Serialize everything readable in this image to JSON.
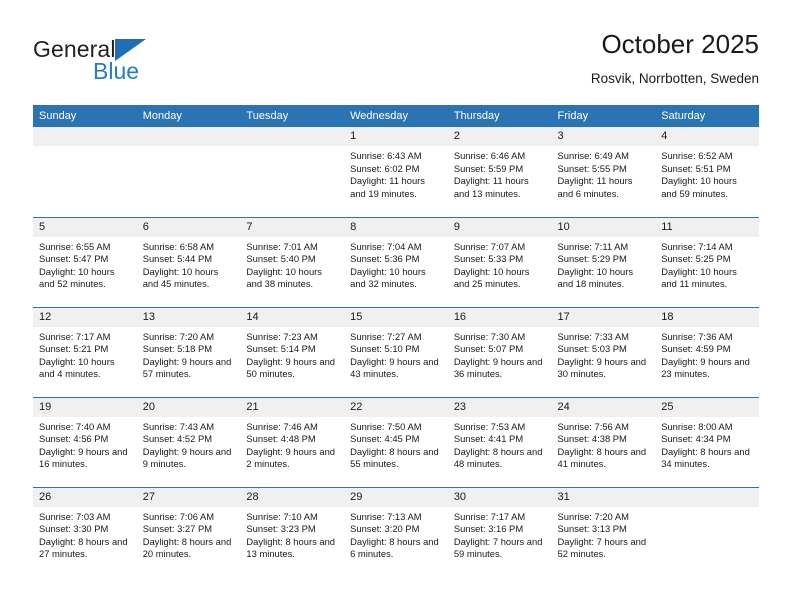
{
  "brand": {
    "name_top": "General",
    "name_bottom": "Blue",
    "logo_icon": "triangle-logo-icon",
    "accent_color": "#1f7ec4"
  },
  "header": {
    "title": "October 2025",
    "subtitle": "Rosvik, Norrbotten, Sweden"
  },
  "theme": {
    "header_blue": "#2b74b4",
    "daynum_band": "#f0f0f0",
    "text": "#1a1a1a"
  },
  "calendar": {
    "weekday_headers": [
      "Sunday",
      "Monday",
      "Tuesday",
      "Wednesday",
      "Thursday",
      "Friday",
      "Saturday"
    ],
    "labels": {
      "sunrise": "Sunrise:",
      "sunset": "Sunset:",
      "daylight": "Daylight:"
    },
    "weeks": [
      [
        {
          "day": "",
          "empty": true
        },
        {
          "day": "",
          "empty": true
        },
        {
          "day": "",
          "empty": true
        },
        {
          "day": "1",
          "sunrise": "Sunrise: 6:43 AM",
          "sunset": "Sunset: 6:02 PM",
          "daylight": "Daylight: 11 hours and 19 minutes."
        },
        {
          "day": "2",
          "sunrise": "Sunrise: 6:46 AM",
          "sunset": "Sunset: 5:59 PM",
          "daylight": "Daylight: 11 hours and 13 minutes."
        },
        {
          "day": "3",
          "sunrise": "Sunrise: 6:49 AM",
          "sunset": "Sunset: 5:55 PM",
          "daylight": "Daylight: 11 hours and 6 minutes."
        },
        {
          "day": "4",
          "sunrise": "Sunrise: 6:52 AM",
          "sunset": "Sunset: 5:51 PM",
          "daylight": "Daylight: 10 hours and 59 minutes."
        }
      ],
      [
        {
          "day": "5",
          "sunrise": "Sunrise: 6:55 AM",
          "sunset": "Sunset: 5:47 PM",
          "daylight": "Daylight: 10 hours and 52 minutes."
        },
        {
          "day": "6",
          "sunrise": "Sunrise: 6:58 AM",
          "sunset": "Sunset: 5:44 PM",
          "daylight": "Daylight: 10 hours and 45 minutes."
        },
        {
          "day": "7",
          "sunrise": "Sunrise: 7:01 AM",
          "sunset": "Sunset: 5:40 PM",
          "daylight": "Daylight: 10 hours and 38 minutes."
        },
        {
          "day": "8",
          "sunrise": "Sunrise: 7:04 AM",
          "sunset": "Sunset: 5:36 PM",
          "daylight": "Daylight: 10 hours and 32 minutes."
        },
        {
          "day": "9",
          "sunrise": "Sunrise: 7:07 AM",
          "sunset": "Sunset: 5:33 PM",
          "daylight": "Daylight: 10 hours and 25 minutes."
        },
        {
          "day": "10",
          "sunrise": "Sunrise: 7:11 AM",
          "sunset": "Sunset: 5:29 PM",
          "daylight": "Daylight: 10 hours and 18 minutes."
        },
        {
          "day": "11",
          "sunrise": "Sunrise: 7:14 AM",
          "sunset": "Sunset: 5:25 PM",
          "daylight": "Daylight: 10 hours and 11 minutes."
        }
      ],
      [
        {
          "day": "12",
          "sunrise": "Sunrise: 7:17 AM",
          "sunset": "Sunset: 5:21 PM",
          "daylight": "Daylight: 10 hours and 4 minutes."
        },
        {
          "day": "13",
          "sunrise": "Sunrise: 7:20 AM",
          "sunset": "Sunset: 5:18 PM",
          "daylight": "Daylight: 9 hours and 57 minutes."
        },
        {
          "day": "14",
          "sunrise": "Sunrise: 7:23 AM",
          "sunset": "Sunset: 5:14 PM",
          "daylight": "Daylight: 9 hours and 50 minutes."
        },
        {
          "day": "15",
          "sunrise": "Sunrise: 7:27 AM",
          "sunset": "Sunset: 5:10 PM",
          "daylight": "Daylight: 9 hours and 43 minutes."
        },
        {
          "day": "16",
          "sunrise": "Sunrise: 7:30 AM",
          "sunset": "Sunset: 5:07 PM",
          "daylight": "Daylight: 9 hours and 36 minutes."
        },
        {
          "day": "17",
          "sunrise": "Sunrise: 7:33 AM",
          "sunset": "Sunset: 5:03 PM",
          "daylight": "Daylight: 9 hours and 30 minutes."
        },
        {
          "day": "18",
          "sunrise": "Sunrise: 7:36 AM",
          "sunset": "Sunset: 4:59 PM",
          "daylight": "Daylight: 9 hours and 23 minutes."
        }
      ],
      [
        {
          "day": "19",
          "sunrise": "Sunrise: 7:40 AM",
          "sunset": "Sunset: 4:56 PM",
          "daylight": "Daylight: 9 hours and 16 minutes."
        },
        {
          "day": "20",
          "sunrise": "Sunrise: 7:43 AM",
          "sunset": "Sunset: 4:52 PM",
          "daylight": "Daylight: 9 hours and 9 minutes."
        },
        {
          "day": "21",
          "sunrise": "Sunrise: 7:46 AM",
          "sunset": "Sunset: 4:48 PM",
          "daylight": "Daylight: 9 hours and 2 minutes."
        },
        {
          "day": "22",
          "sunrise": "Sunrise: 7:50 AM",
          "sunset": "Sunset: 4:45 PM",
          "daylight": "Daylight: 8 hours and 55 minutes."
        },
        {
          "day": "23",
          "sunrise": "Sunrise: 7:53 AM",
          "sunset": "Sunset: 4:41 PM",
          "daylight": "Daylight: 8 hours and 48 minutes."
        },
        {
          "day": "24",
          "sunrise": "Sunrise: 7:56 AM",
          "sunset": "Sunset: 4:38 PM",
          "daylight": "Daylight: 8 hours and 41 minutes."
        },
        {
          "day": "25",
          "sunrise": "Sunrise: 8:00 AM",
          "sunset": "Sunset: 4:34 PM",
          "daylight": "Daylight: 8 hours and 34 minutes."
        }
      ],
      [
        {
          "day": "26",
          "sunrise": "Sunrise: 7:03 AM",
          "sunset": "Sunset: 3:30 PM",
          "daylight": "Daylight: 8 hours and 27 minutes."
        },
        {
          "day": "27",
          "sunrise": "Sunrise: 7:06 AM",
          "sunset": "Sunset: 3:27 PM",
          "daylight": "Daylight: 8 hours and 20 minutes."
        },
        {
          "day": "28",
          "sunrise": "Sunrise: 7:10 AM",
          "sunset": "Sunset: 3:23 PM",
          "daylight": "Daylight: 8 hours and 13 minutes."
        },
        {
          "day": "29",
          "sunrise": "Sunrise: 7:13 AM",
          "sunset": "Sunset: 3:20 PM",
          "daylight": "Daylight: 8 hours and 6 minutes."
        },
        {
          "day": "30",
          "sunrise": "Sunrise: 7:17 AM",
          "sunset": "Sunset: 3:16 PM",
          "daylight": "Daylight: 7 hours and 59 minutes."
        },
        {
          "day": "31",
          "sunrise": "Sunrise: 7:20 AM",
          "sunset": "Sunset: 3:13 PM",
          "daylight": "Daylight: 7 hours and 52 minutes."
        },
        {
          "day": "",
          "empty": true
        }
      ]
    ]
  }
}
